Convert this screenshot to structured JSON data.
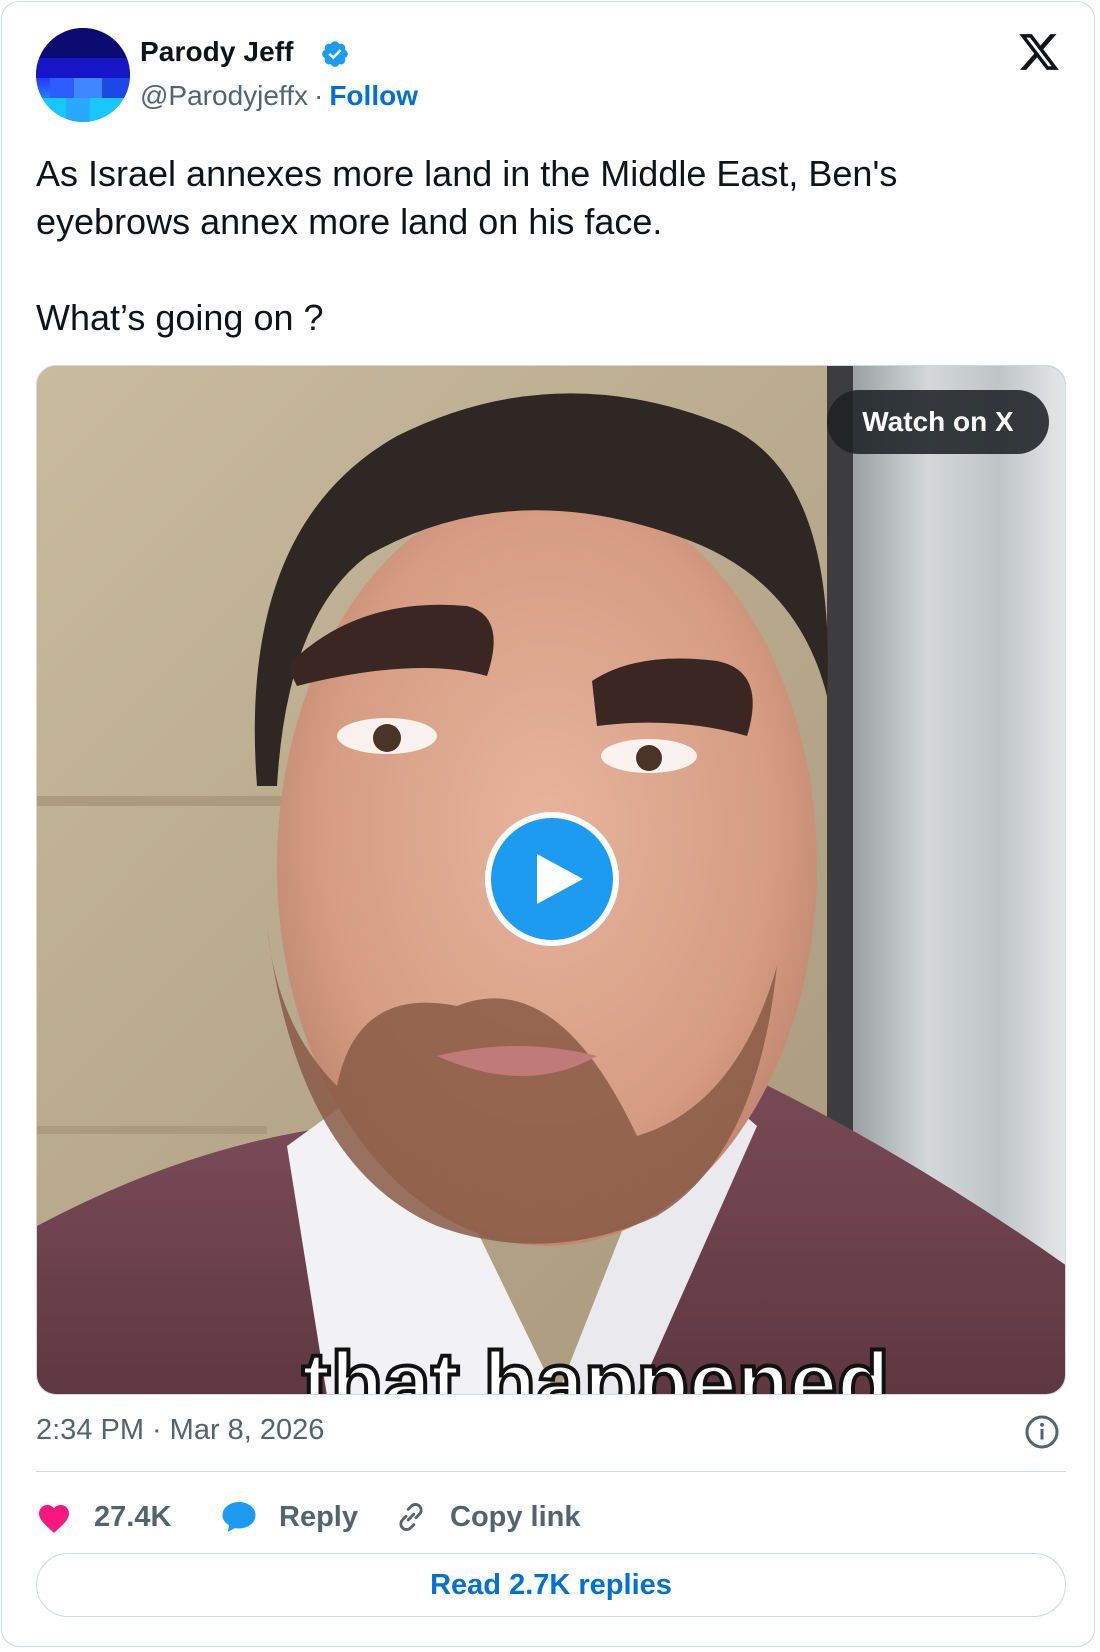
{
  "author": {
    "name": "Parody Jeff",
    "handle": "@Parodyjeffx",
    "separator": "·",
    "follow_label": "Follow",
    "verified_icon": "verified-badge-icon"
  },
  "tweet": {
    "line1": "As Israel annexes more land in the Middle East, Ben's eyebrows annex more land on his face.",
    "line2": "What’s going on ?"
  },
  "media": {
    "watch_label": "Watch on X",
    "caption_fragment": "that happened",
    "play_icon": "play-icon"
  },
  "meta": {
    "time": "2:34 PM",
    "separator": "·",
    "date": "Mar 8, 2026"
  },
  "actions": {
    "like_count": "27.4K",
    "reply_label": "Reply",
    "copy_label": "Copy link"
  },
  "footer": {
    "read_replies_label": "Read 2.7K replies"
  },
  "colors": {
    "accent_blue": "#1d9bf0",
    "link_blue": "#006fd6",
    "like_pink": "#f91880",
    "muted_text": "#536471"
  }
}
